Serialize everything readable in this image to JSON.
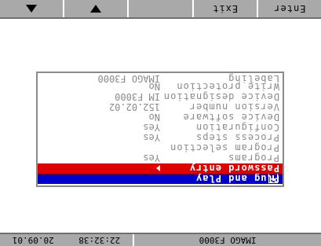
{
  "softkeys": {
    "key1": "up-arrow",
    "key2": "down-arrow",
    "key3": "",
    "key4": "Exit",
    "key5": "Enter"
  },
  "status": {
    "device": "IMAGO F3000",
    "time": "22:32:38",
    "date": "20.09.01"
  },
  "menu": {
    "items": [
      {
        "label": "Plug and Play",
        "value": ""
      },
      {
        "label": "Password entry",
        "value": ""
      },
      {
        "label": "Programs",
        "value": "Yes"
      },
      {
        "label": "Program selection",
        "value": ""
      },
      {
        "label": "Process steps",
        "value": "Yes"
      },
      {
        "label": "Configuration",
        "value": "Yes"
      },
      {
        "label": "Device software",
        "value": "No"
      },
      {
        "label": "Version number",
        "value": "152.02.02"
      },
      {
        "label": "Device designation",
        "value": "IM F3000"
      },
      {
        "label": "Write protection",
        "value": "No"
      },
      {
        "label": "Labeling",
        "value": "IMAGO F3000"
      }
    ]
  },
  "colors": {
    "selected": "#0000c8",
    "alert": "#e00000",
    "bar": "#a9a9a9"
  }
}
